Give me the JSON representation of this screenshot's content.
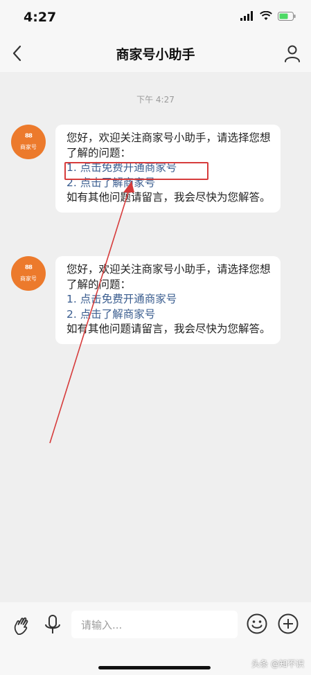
{
  "status_bar": {
    "time": "4:27"
  },
  "nav": {
    "title": "商家号小助手"
  },
  "chat": {
    "timestamp": "下午 4:27",
    "avatar": {
      "logo": "⁸⁸",
      "label": "商家号"
    },
    "messages": [
      {
        "line1": "您好，欢迎关注商家号小助手，请选择您想了解的问题：",
        "option1": "1. 点击免费开通商家号",
        "option2": "2. 点击了解商家号",
        "line2": "如有其他问题请留言，我会尽快为您解答。"
      },
      {
        "line1": "您好，欢迎关注商家号小助手，请选择您想了解的问题：",
        "option1": "1. 点击免费开通商家号",
        "option2": "2. 点击了解商家号",
        "line2": "如有其他问题请留言，我会尽快为您解答。"
      }
    ]
  },
  "input": {
    "placeholder": "请输入..."
  },
  "watermark": "头条 @知不识",
  "colors": {
    "link": "#3a5d8f",
    "avatar": "#ec7a2c",
    "annotation": "#d63b3b"
  }
}
